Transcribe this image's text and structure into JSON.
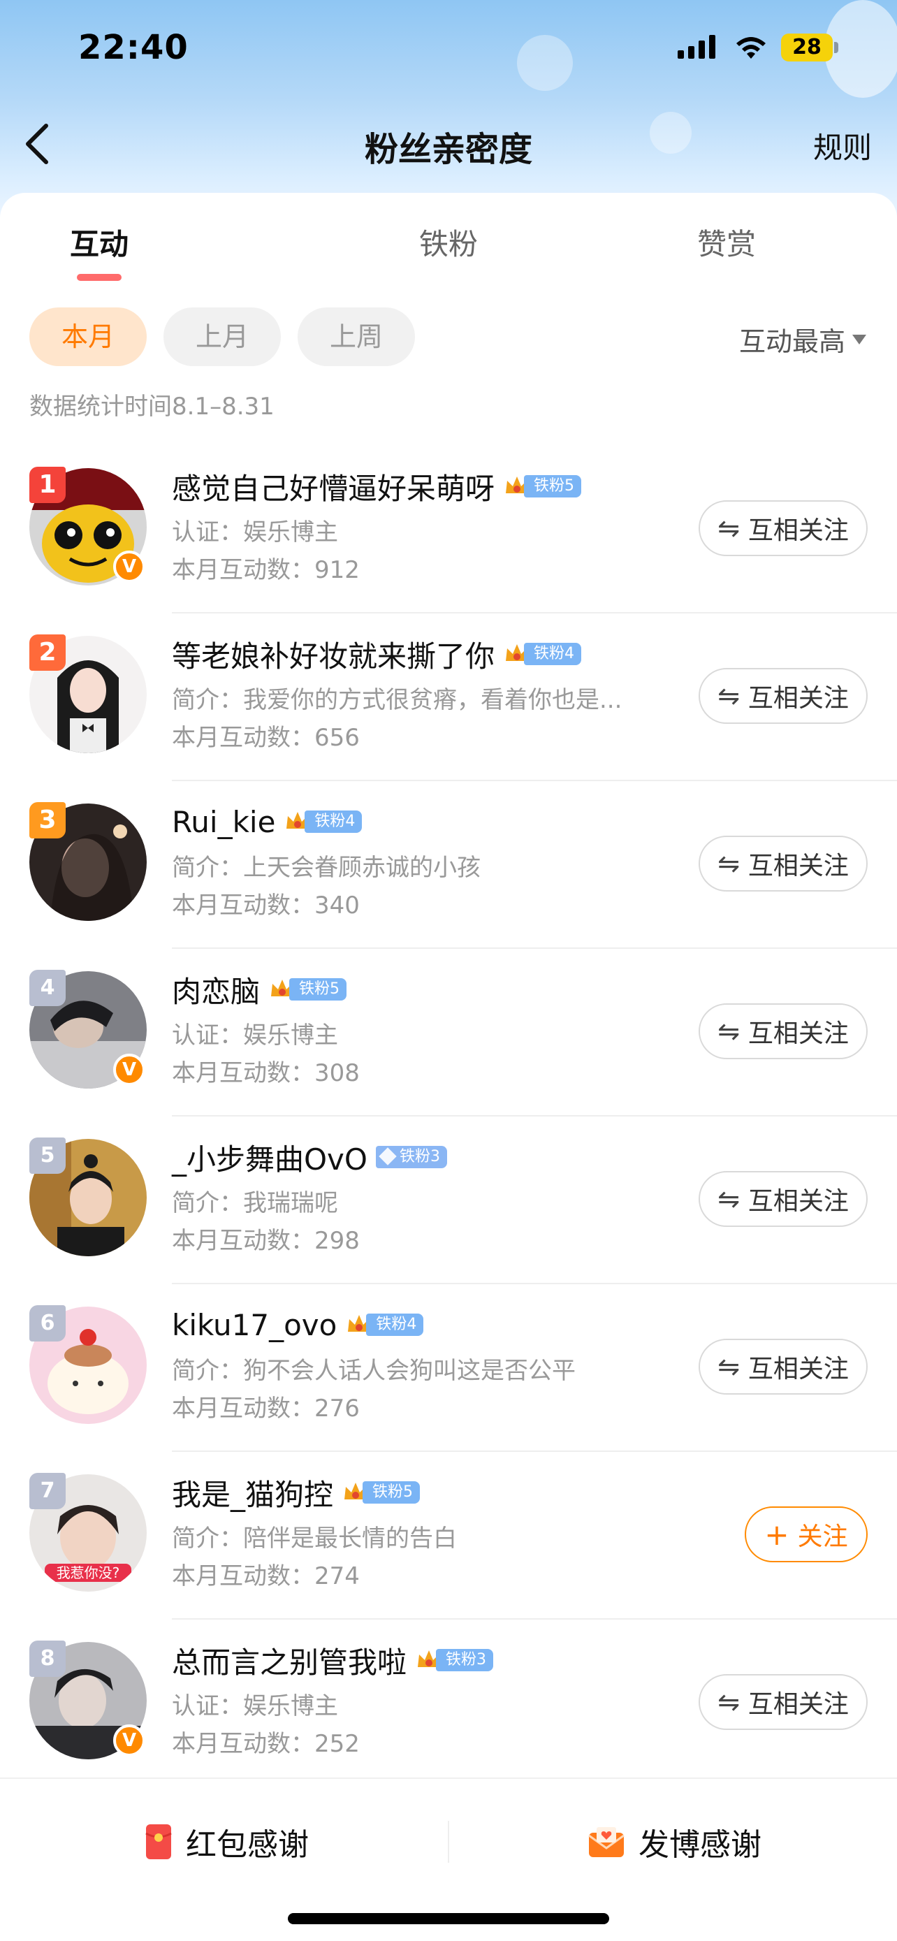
{
  "status_bar": {
    "time": "22:40",
    "battery": "28"
  },
  "header": {
    "title": "粉丝亲密度",
    "rules_label": "规则"
  },
  "tabs": [
    {
      "label": "互动"
    },
    {
      "label": "铁粉"
    },
    {
      "label": "赞赏"
    }
  ],
  "filters": {
    "chips": [
      "本月",
      "上月",
      "上周"
    ],
    "sort_label": "互动最高"
  },
  "stat_time": "数据统计时间8.1–8.31",
  "fans": [
    {
      "rank": "1",
      "name": "感觉自己好懵逼好呆萌呀",
      "badge": "铁粉5",
      "desc": "认证：娱乐博主",
      "count": "本月互动数：912",
      "button": "互相关注",
      "verified": true
    },
    {
      "rank": "2",
      "name": "等老娘补好妆就来撕了你",
      "badge": "铁粉4",
      "desc": "简介：我爱你的方式很贫瘠，看着你也是...",
      "count": "本月互动数：656",
      "button": "互相关注",
      "verified": false
    },
    {
      "rank": "3",
      "name": "Rui_kie",
      "badge": "铁粉4",
      "desc": "简介：上天会眷顾赤诚的小孩",
      "count": "本月互动数：340",
      "button": "互相关注",
      "verified": false
    },
    {
      "rank": "4",
      "name": "肉恋脑",
      "badge": "铁粉5",
      "desc": "认证：娱乐博主",
      "count": "本月互动数：308",
      "button": "互相关注",
      "verified": true
    },
    {
      "rank": "5",
      "name": "_小步舞曲OvO",
      "badge": "铁粉3",
      "desc": "简介：我瑞瑞呢",
      "count": "本月互动数：298",
      "button": "互相关注",
      "verified": false
    },
    {
      "rank": "6",
      "name": "kiku17_ovo",
      "badge": "铁粉4",
      "desc": "简介：狗不会人话人会狗叫这是否公平",
      "count": "本月互动数：276",
      "button": "互相关注",
      "verified": false
    },
    {
      "rank": "7",
      "name": "我是_猫狗控",
      "badge": "铁粉5",
      "desc": "简介：陪伴是最长情的告白",
      "count": "本月互动数：274",
      "button": "关注",
      "verified": false,
      "avatar_text": "我惹你没?"
    },
    {
      "rank": "8",
      "name": "总而言之别管我啦",
      "badge": "铁粉3",
      "desc": "认证：娱乐博主",
      "count": "本月互动数：252",
      "button": "互相关注",
      "verified": true
    }
  ],
  "bottom_bar": {
    "red_packet_label": "红包感谢",
    "post_label": "发博感谢"
  },
  "colors": {
    "accent": "#ff7a00",
    "tab_underline": "#ff6b6b",
    "fan_badge": "#7ab4f5"
  }
}
